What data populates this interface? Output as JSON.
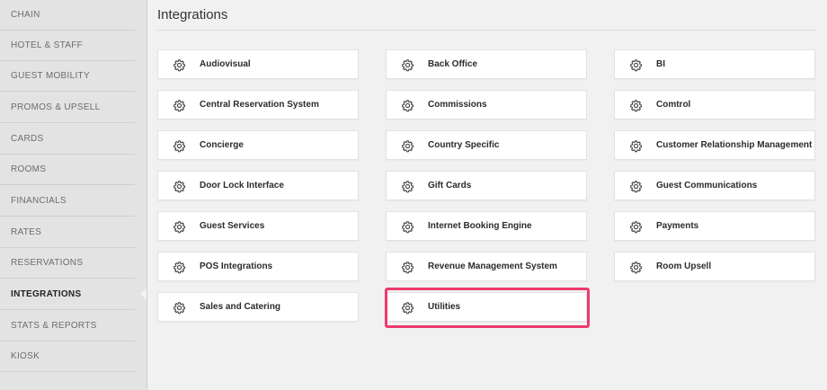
{
  "sidebar": {
    "items": [
      {
        "label": "CHAIN",
        "active": false
      },
      {
        "label": "HOTEL & STAFF",
        "active": false
      },
      {
        "label": "GUEST MOBILITY",
        "active": false
      },
      {
        "label": "PROMOS & UPSELL",
        "active": false
      },
      {
        "label": "CARDS",
        "active": false
      },
      {
        "label": "ROOMS",
        "active": false
      },
      {
        "label": "FINANCIALS",
        "active": false
      },
      {
        "label": "RATES",
        "active": false
      },
      {
        "label": "RESERVATIONS",
        "active": false
      },
      {
        "label": "INTEGRATIONS",
        "active": true
      },
      {
        "label": "STATS & REPORTS",
        "active": false
      },
      {
        "label": "KIOSK",
        "active": false
      }
    ]
  },
  "main": {
    "title": "Integrations",
    "highlight_color": "#ee3a6c",
    "card_icon": "gear-icon",
    "columns": [
      [
        "Audiovisual",
        "Central Reservation System",
        "Concierge",
        "Door Lock Interface",
        "Guest Services",
        "POS Integrations",
        "Sales and Catering"
      ],
      [
        "Back Office",
        "Commissions",
        "Country Specific",
        "Gift Cards",
        "Internet Booking Engine",
        "Revenue Management System",
        "Utilities"
      ],
      [
        "BI",
        "Comtrol",
        "Customer Relationship Management",
        "Guest Communications",
        "Payments",
        "Room Upsell"
      ]
    ],
    "highlighted": "Utilities"
  }
}
